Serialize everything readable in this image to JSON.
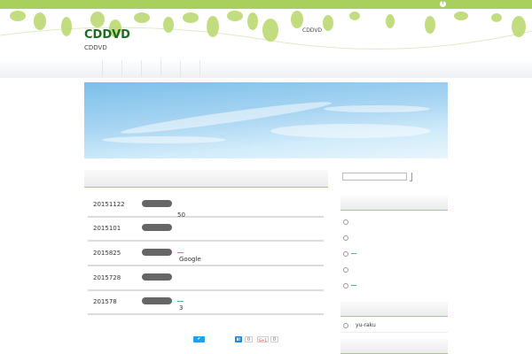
{
  "header": {
    "site_title": "CDDVD",
    "site_description": "CDDVD",
    "tagline": "CDDVD",
    "top_icon": "?"
  },
  "posts": [
    {
      "date": "20151122",
      "excerpt": "50",
      "has_link": false
    },
    {
      "date": "2015101",
      "excerpt": "",
      "has_link": false
    },
    {
      "date": "2015825",
      "excerpt": "Google",
      "has_link": true
    },
    {
      "date": "2015728",
      "excerpt": "",
      "has_link": false
    },
    {
      "date": "201578",
      "excerpt": "3",
      "has_link": true
    }
  ],
  "sidebar": {
    "recent_author": "yu-raku"
  },
  "share": {
    "twitter_icon": "twitter-icon",
    "hatena_label": "B!",
    "hatena_count": "0",
    "gplus_label": "G+1",
    "gplus_count": "0"
  },
  "colors": {
    "accent": "#a9cf5c",
    "title": "#1e6b1e",
    "twitter": "#1da1f2"
  }
}
